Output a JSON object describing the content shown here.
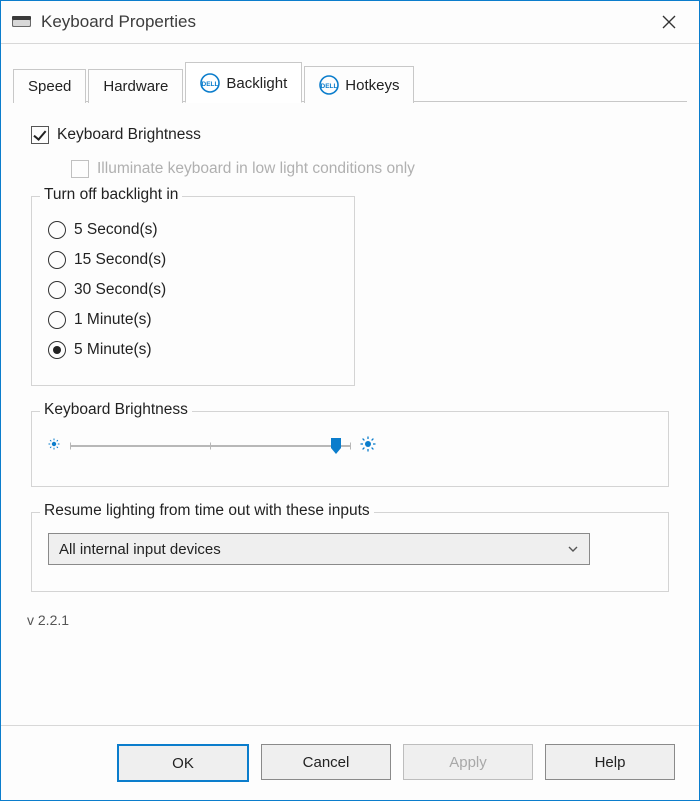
{
  "window": {
    "title": "Keyboard Properties"
  },
  "tabs": [
    {
      "label": "Speed",
      "icon": null,
      "active": false
    },
    {
      "label": "Hardware",
      "icon": null,
      "active": false
    },
    {
      "label": "Backlight",
      "icon": "dell",
      "active": true
    },
    {
      "label": "Hotkeys",
      "icon": "dell",
      "active": false
    }
  ],
  "brightness_checkbox": {
    "label": "Keyboard Brightness",
    "checked": true
  },
  "low_light_checkbox": {
    "label": "Illuminate keyboard in low light conditions only",
    "checked": false,
    "enabled": false
  },
  "turn_off_group": {
    "title": "Turn off backlight in",
    "options": [
      {
        "label": "5 Second(s)",
        "selected": false
      },
      {
        "label": "15 Second(s)",
        "selected": false
      },
      {
        "label": "30 Second(s)",
        "selected": false
      },
      {
        "label": "1 Minute(s)",
        "selected": false
      },
      {
        "label": "5 Minute(s)",
        "selected": true
      }
    ]
  },
  "slider_group": {
    "title": "Keyboard Brightness",
    "value_percent": 95
  },
  "resume_group": {
    "title": "Resume lighting from time out with these inputs",
    "selected": "All internal input devices"
  },
  "version": "v 2.2.1",
  "buttons": {
    "ok": "OK",
    "cancel": "Cancel",
    "apply": "Apply",
    "help": "Help"
  },
  "colors": {
    "accent": "#0b7dcc"
  }
}
